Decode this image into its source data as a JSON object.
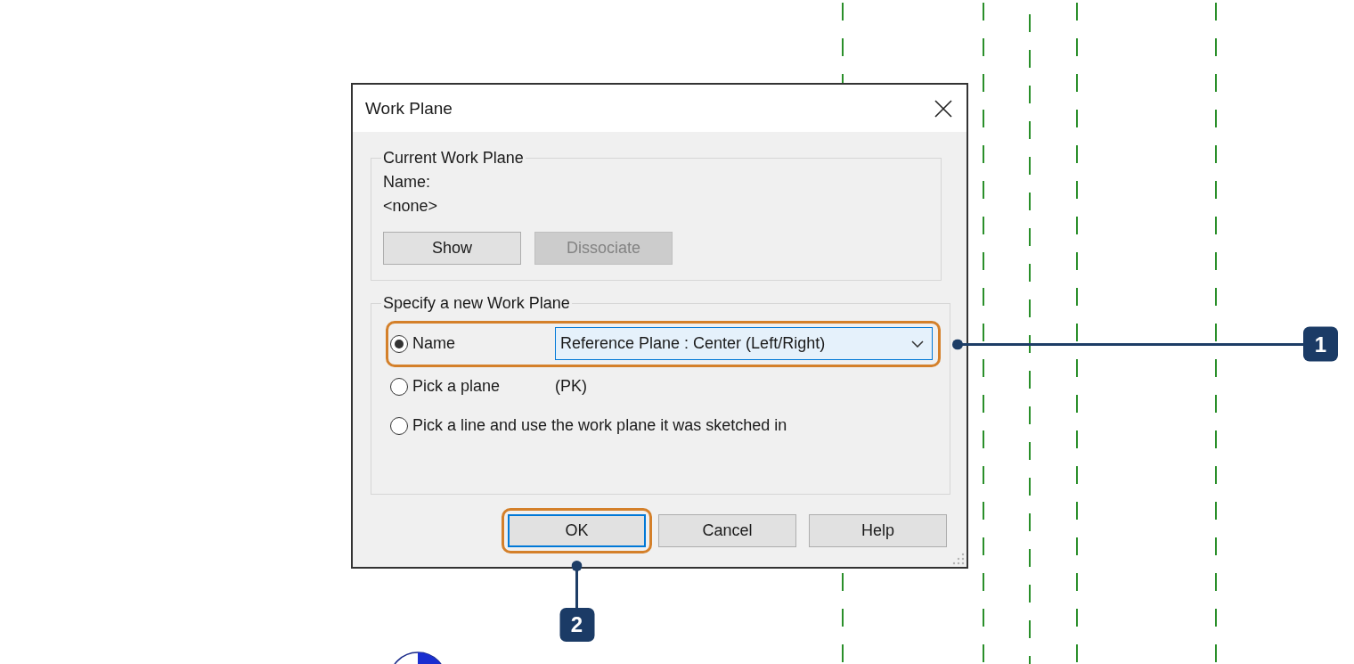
{
  "dialog": {
    "title": "Work Plane",
    "current_group": {
      "legend": "Current Work Plane",
      "name_label": "Name:",
      "name_value": "<none>",
      "buttons": [
        {
          "label": "Show",
          "disabled": false
        },
        {
          "label": "Dissociate",
          "disabled": true
        }
      ]
    },
    "new_group": {
      "legend": "Specify a new Work Plane",
      "options": [
        {
          "kind": "dropdown",
          "label": "Name",
          "selected": true,
          "value": "Reference Plane : Center (Left/Right)",
          "focused": true,
          "callout": "1"
        },
        {
          "kind": "shortcut",
          "label": "Pick a plane",
          "selected": false,
          "shortcut": "(PK)"
        },
        {
          "kind": "plain",
          "label": "Pick a line and use the work plane it was sketched in",
          "selected": false
        }
      ]
    },
    "buttons": [
      {
        "label": "OK",
        "focused": true,
        "callout": "2"
      },
      {
        "label": "Cancel",
        "focused": false
      },
      {
        "label": "Help",
        "focused": false
      }
    ]
  }
}
